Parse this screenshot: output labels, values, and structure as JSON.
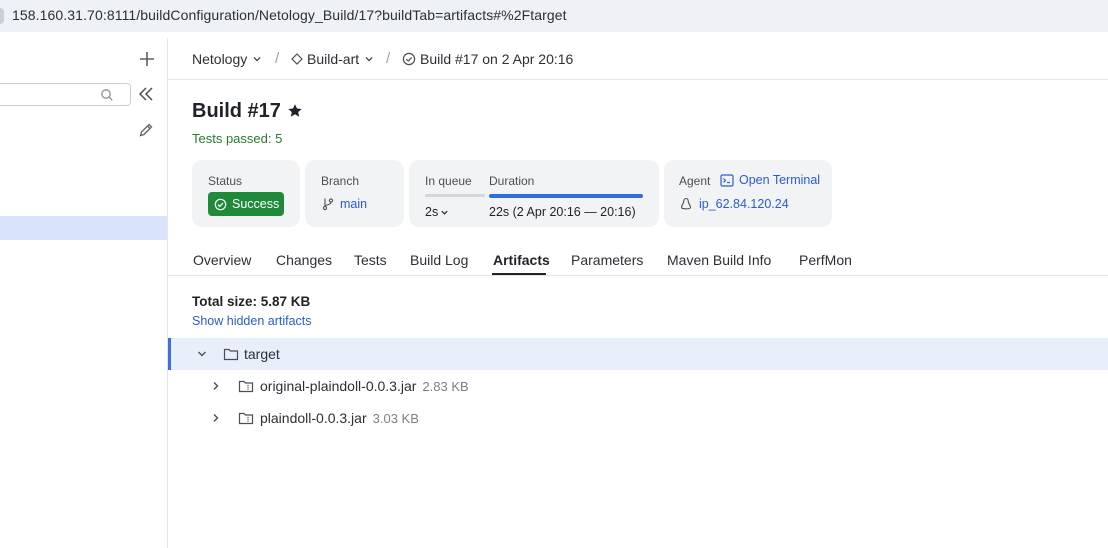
{
  "browser": {
    "url_host": "158.160.31.70",
    "url_rest": ":8111/buildConfiguration/Netology_Build/17?buildTab=artifacts#%2Ftarget"
  },
  "breadcrumbs": {
    "project": "Netology",
    "build_config": "Build-art",
    "build": "Build #17 on 2 Apr 20:16",
    "separator": "/"
  },
  "build": {
    "title": "Build #17",
    "tests_text": "Tests passed: 5"
  },
  "cards": {
    "status": {
      "label": "Status",
      "value": "Success",
      "color": "#1f8a3a"
    },
    "branch": {
      "label": "Branch",
      "value": "main"
    },
    "queue": {
      "label": "In queue",
      "value": "2s"
    },
    "duration": {
      "label": "Duration",
      "value": "22s (2 Apr 20:16 — 20:16)"
    },
    "agent": {
      "label": "Agent",
      "terminal_link": "Open Terminal",
      "value": "ip_62.84.120.24"
    }
  },
  "tabs": [
    {
      "label": "Overview"
    },
    {
      "label": "Changes"
    },
    {
      "label": "Tests"
    },
    {
      "label": "Build Log"
    },
    {
      "label": "Artifacts",
      "active": true
    },
    {
      "label": "Parameters"
    },
    {
      "label": "Maven Build Info"
    },
    {
      "label": "PerfMon"
    }
  ],
  "artifacts": {
    "total_size": "Total size: 5.87 KB",
    "show_hidden": "Show hidden artifacts",
    "folder": "target",
    "files": [
      {
        "name": "original-plaindoll-0.0.3.jar",
        "size": "2.83 KB"
      },
      {
        "name": "plaindoll-0.0.3.jar",
        "size": "3.03 KB"
      }
    ]
  },
  "colors": {
    "accent": "#2a5bd7",
    "success": "#1f8a3a",
    "selection": "#e9eefb"
  }
}
